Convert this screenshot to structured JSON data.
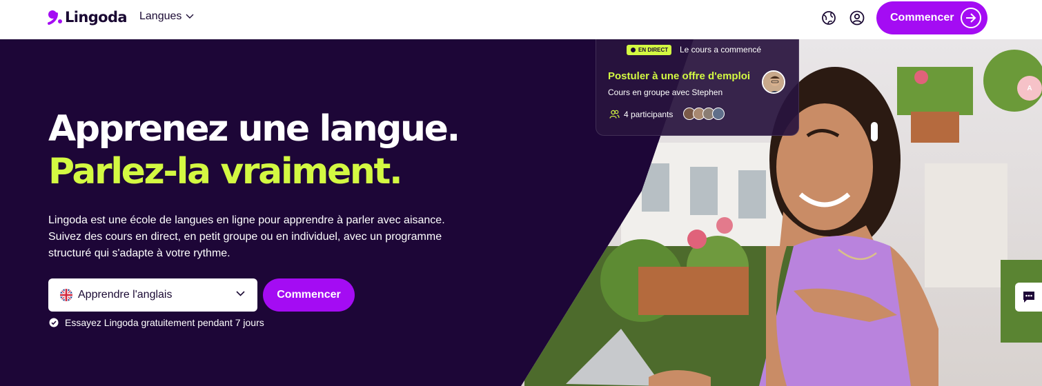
{
  "header": {
    "logo_text": "Lingoda",
    "nav_langues": "Langues",
    "cta": "Commencer",
    "icons": [
      "globe-icon",
      "user-account-icon",
      "arrow-right-icon"
    ]
  },
  "hero": {
    "headline_line1": "Apprenez une langue.",
    "headline_line2": "Parlez-la vraiment.",
    "description": "Lingoda est une école de langues en ligne pour apprendre à parler avec aisance. Suivez des cours en direct, en petit groupe ou en individuel, avec un programme structuré qui s'adapte à votre rythme.",
    "language_select": {
      "selected": "Apprendre l'anglais"
    },
    "cta": "Commencer",
    "trial_note": "Essayez Lingoda gratuitement pendant 7 jours"
  },
  "live_card": {
    "badge": "EN DIRECT",
    "status": "Le cours a commencé",
    "title": "Postuler à une offre d'emploi",
    "subtitle": "Cours en groupe avec Stephen",
    "participants": "4 participants"
  },
  "colors": {
    "brand_purple": "#a40cf3",
    "hero_bg": "#1d0637",
    "accent_lime": "#d3f942",
    "logo_dark": "#1a0933"
  }
}
